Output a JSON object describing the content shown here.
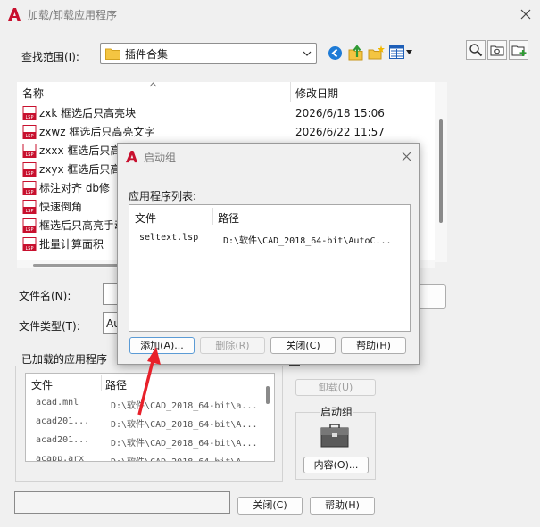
{
  "main_dialog": {
    "title": "加载/卸载应用程序",
    "look_in_label": "查找范围(I):",
    "look_in_value": "插件合集",
    "columns": {
      "name": "名称",
      "modified": "修改日期"
    },
    "files": [
      {
        "name": "zxk 框选后只高亮块",
        "date": "2026/6/18 15:06"
      },
      {
        "name": "zxwz 框选后只高亮文字",
        "date": "2026/6/22 11:57"
      },
      {
        "name": "zxxx 框选后只高亮",
        "date": ""
      },
      {
        "name": "zxyx 框选后只高亮",
        "date": ""
      },
      {
        "name": "标注对齐  db修",
        "date": ""
      },
      {
        "name": "快速倒角",
        "date": ""
      },
      {
        "name": "框选后只高亮手动",
        "date": ""
      },
      {
        "name": "批量计算面积",
        "date": ""
      }
    ],
    "filename_label": "文件名(N):",
    "filetype_label": "文件类型(T):",
    "filetype_value": "Au",
    "loaded_group_label": "已加载的应用程序",
    "loaded_columns": {
      "file": "文件",
      "path": "路径"
    },
    "loaded_rows": [
      {
        "file": "acad.mnl",
        "path": "D:\\软件\\CAD_2018_64-bit\\a..."
      },
      {
        "file": "acad201...",
        "path": "D:\\软件\\CAD_2018_64-bit\\A..."
      },
      {
        "file": "acad201...",
        "path": "D:\\软件\\CAD_2018_64-bit\\A..."
      },
      {
        "file": "acapp.arx",
        "path": "D:\\软件\\CAD_2018_64-bit\\A..."
      }
    ],
    "unload_label": "卸载(U)",
    "startup_group_label": "启动组",
    "contents_label": "内容(O)...",
    "close_label": "关闭(C)",
    "help_label": "帮助(H)"
  },
  "startup_dialog": {
    "title": "启动组",
    "list_label": "应用程序列表:",
    "columns": {
      "file": "文件",
      "path": "路径"
    },
    "rows": [
      {
        "file": "seltext.lsp",
        "path": "D:\\软件\\CAD_2018_64-bit\\AutoC..."
      }
    ],
    "add_label": "添加(A)...",
    "remove_label": "删除(R)",
    "close_label": "关闭(C)",
    "help_label": "帮助(H)"
  },
  "colors": {
    "autocad_red": "#c8102e",
    "arrow_red": "#e8202a",
    "folder_yellow": "#f4c542"
  }
}
